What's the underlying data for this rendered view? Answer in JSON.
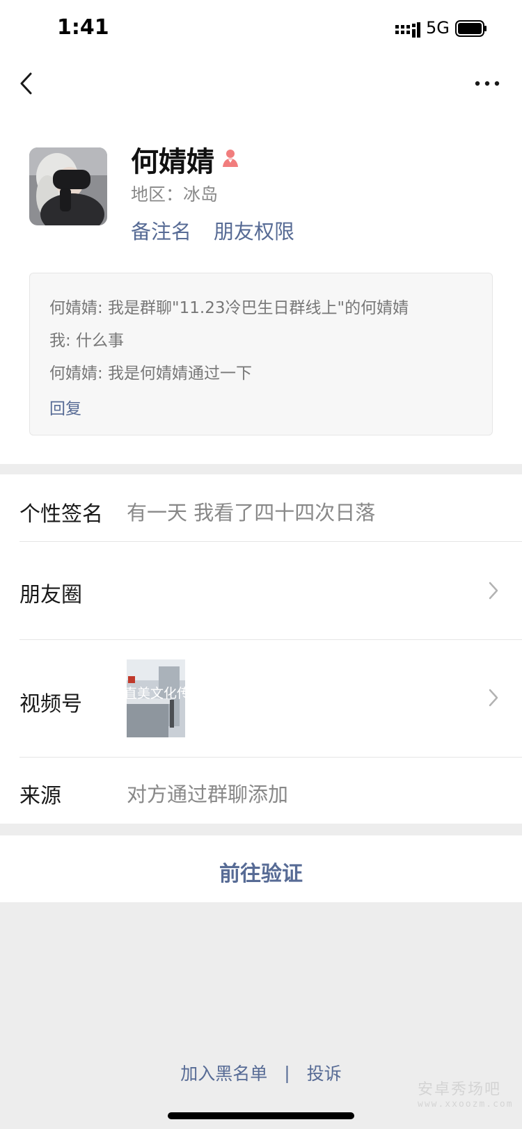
{
  "status_bar": {
    "time": "1:41",
    "network": "5G"
  },
  "nav": {
    "back_icon": "chevron-left-icon",
    "more_icon": "more-dots-icon"
  },
  "profile": {
    "name": "何婧婧",
    "gender_icon": "female-icon",
    "gender_color": "#fa5151",
    "region": "地区：冰岛",
    "set_remark": "备注名",
    "friend_permissions": "朋友权限"
  },
  "verification_messages": [
    "何婧婧: 我是群聊\"11.23冷巴生日群线上\"的何婧婧",
    "我: 什么事",
    "何婧婧: 我是何婧婧通过一下"
  ],
  "reply_label": "回复",
  "info_rows": {
    "signature": {
      "label": "个性签名",
      "value": "有一天 我看了四十四次日落"
    },
    "moments": {
      "label": "朋友圈"
    },
    "channels": {
      "label": "视频号",
      "thumb_text": "直美文化传"
    },
    "source": {
      "label": "来源",
      "value": "对方通过群聊添加"
    }
  },
  "verify_button": "前往验证",
  "footer": {
    "blacklist": "加入黑名单",
    "separator": "|",
    "report": "投诉"
  },
  "watermark": {
    "text": "安卓秀场吧",
    "sub": "www.xxoozm.com"
  },
  "colors": {
    "link": "#576b95",
    "background": "#ededed",
    "card": "#ffffff",
    "secondary_text": "#888888"
  }
}
